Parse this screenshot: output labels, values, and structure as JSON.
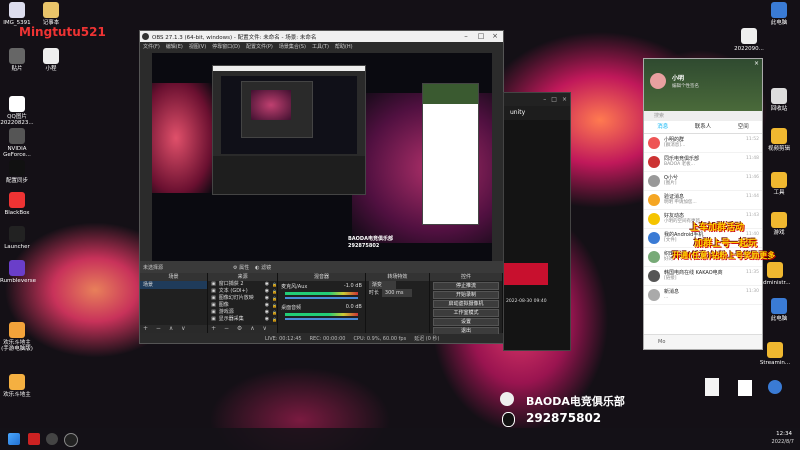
{
  "watermark": "Mingtutu521",
  "desktop_left_icons": [
    {
      "label": "IMG_5391",
      "color": "#dde"
    },
    {
      "label": "记事本",
      "color": "#e9c46a"
    },
    {
      "label": "贴片",
      "color": "#666"
    },
    {
      "label": "小程",
      "color": "#eee"
    },
    {
      "label": "QQ图片20220823...",
      "color": "#fff"
    },
    {
      "label": "NVIDIA GeForce...",
      "color": "#555"
    },
    {
      "label": "配置同步",
      "color": "#111"
    },
    {
      "label": "BlackBox",
      "color": "#e33"
    },
    {
      "label": "Launcher",
      "color": "#222"
    },
    {
      "label": "Rumbleverse",
      "color": "#6a3ec9"
    },
    {
      "label": "欢乐斗地主(手游电脑版)",
      "color": "#f2a23a"
    },
    {
      "label": "欢乐斗地主",
      "color": "#f5b041"
    }
  ],
  "desktop_right_icons": [
    {
      "label": "此电脑",
      "color": "#3a7bd5"
    },
    {
      "label": "2022090...",
      "color": "#eee"
    },
    {
      "label": "回收站",
      "color": "#ddd"
    },
    {
      "label": "视频剪辑",
      "color": "#f0b830"
    },
    {
      "label": "工具",
      "color": "#f0b830"
    },
    {
      "label": "游戏",
      "color": "#f0b830"
    },
    {
      "label": "Administr...",
      "color": "#f0b830"
    },
    {
      "label": "此电脑",
      "color": "#3a7bd5"
    },
    {
      "label": "Streamin...",
      "color": "#f0b830"
    }
  ],
  "obs": {
    "title": "OBS 27.1.3 (64-bit, windows) - 配置文件: 未命名 - 场景: 未命名",
    "menu": [
      "文件(F)",
      "编辑(E)",
      "视图(V)",
      "停靠窗口(D)",
      "配置文件(P)",
      "场景集合(S)",
      "工具(T)",
      "帮助(H)"
    ],
    "scene_bar": {
      "label": "未选择源",
      "properties": "属性",
      "filters": "滤镜"
    },
    "docks": {
      "scenes": {
        "header": "场景",
        "items": [
          "场景"
        ]
      },
      "sources": {
        "header": "来源",
        "items": [
          "窗口捕获 2",
          "文本 (GDI+)",
          "图像幻灯片放映",
          "图像",
          "游戏源",
          "显示器采集"
        ]
      },
      "mixer": {
        "header": "混音器",
        "items": [
          {
            "name": "麦克风/Aux",
            "db": "-1.0 dB"
          },
          {
            "name": "桌面音频",
            "db": "0.0 dB"
          }
        ]
      },
      "transitions": {
        "header": "转场特效",
        "type": "渐变",
        "duration_label": "时长",
        "duration": "300 ms"
      },
      "controls": {
        "header": "控件",
        "buttons": [
          "停止推流",
          "开始录制",
          "启动虚拟摄像机",
          "工作室模式",
          "设置",
          "退出"
        ]
      }
    },
    "status": {
      "live": "LIVE: 00:12:45",
      "rec": "REC: 00:00:00",
      "cpu": "CPU: 0.9%, 60.00 fps",
      "dropped": "延迟 (0 秒)"
    }
  },
  "small_window_title": "unity",
  "qq": {
    "user_name": "小明",
    "status": "编辑个性签名",
    "search_placeholder": "搜索",
    "tabs": [
      "消息",
      "联系人",
      "空间"
    ],
    "items": [
      {
        "name": "小明的群",
        "msg": "[群消息]...",
        "time": "11:52",
        "color": "#e55"
      },
      {
        "name": "同乐电竞俱乐部",
        "msg": "BADOA 老板...",
        "time": "11:48",
        "color": "#c33"
      },
      {
        "name": "Q小兮",
        "msg": "[图片]",
        "time": "11:46",
        "color": "#999"
      },
      {
        "name": "验证消息",
        "msg": "明明 申请加您...",
        "time": "11:44",
        "color": "#f5a623"
      },
      {
        "name": "好友动态",
        "msg": "小明的空间有更新",
        "time": "11:43",
        "color": "#f5c400"
      },
      {
        "name": "我的Android手机",
        "msg": "[文件]",
        "time": "11:40",
        "color": "#3a7bd5"
      },
      {
        "name": "织田",
        "msg": "好的",
        "time": "11:38",
        "color": "#7a7"
      },
      {
        "name": "韩国电商在线 KAKAO电商",
        "msg": "[链接]",
        "time": "11:35",
        "color": "#555"
      },
      {
        "name": "新消息",
        "msg": "...",
        "time": "11:30",
        "color": "#aaa"
      }
    ],
    "bottom_text": "Mo"
  },
  "overlay_lines": [
    "上车加群活动",
    "加群上号一起玩",
    "开通(任意)钻粉上号奖励更多"
  ],
  "club": {
    "name": "BAODA电竞俱乐部",
    "qq": "292875802"
  },
  "overlay_date": "2022-08-30 09:40",
  "taskbar_time": "12:34",
  "taskbar_date": "2022/8/7"
}
